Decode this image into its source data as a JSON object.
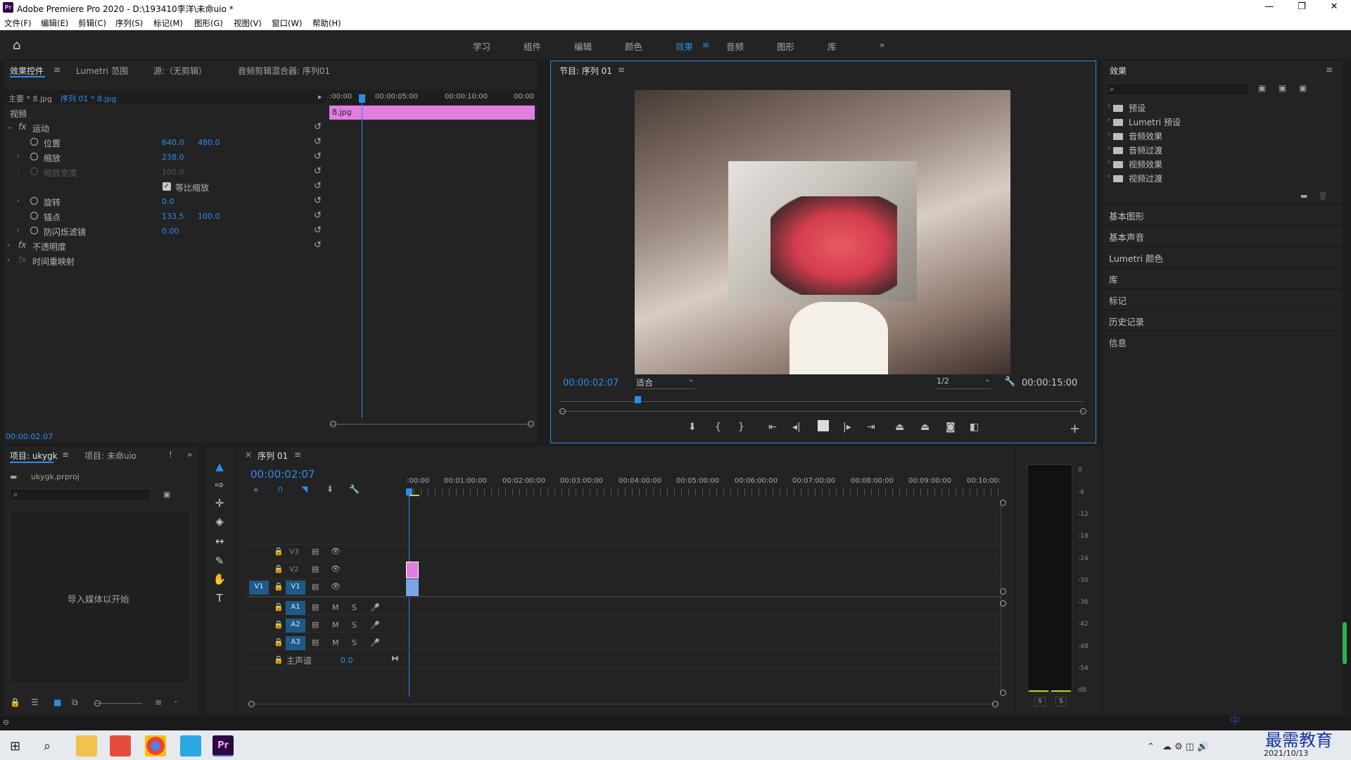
{
  "window": {
    "title": "Adobe Premiere Pro 2020 - D:\\193410李洋\\未命uio *",
    "logo": "Pr"
  },
  "menu": [
    "文件(F)",
    "编辑(E)",
    "剪辑(C)",
    "序列(S)",
    "标记(M)",
    "图形(G)",
    "视图(V)",
    "窗口(W)",
    "帮助(H)"
  ],
  "workspaces": [
    "学习",
    "组件",
    "编辑",
    "颜色",
    "效果",
    "音频",
    "图形",
    "库"
  ],
  "effect_controls": {
    "tabs": [
      "效果控件",
      "Lumetri 范围",
      "源:（无剪辑）",
      "音频剪辑混合器: 序列01"
    ],
    "master": "主要 * 8.jpg",
    "sequence": "序列 01 * 8.jpg",
    "timecodes": [
      ":00:00",
      "00:00:05:00",
      "00:00:10:00",
      "00:00"
    ],
    "clip_name": "8.jpg",
    "section": "视频",
    "motion": "运动",
    "props": {
      "position": {
        "label": "位置",
        "x": "640.0",
        "y": "480.0"
      },
      "scale": {
        "label": "缩放",
        "v": "238.0"
      },
      "scale_width": {
        "label": "缩放宽度",
        "v": "100.0"
      },
      "uniform": "等比缩放",
      "rotation": {
        "label": "旋转",
        "v": "0.0"
      },
      "anchor": {
        "label": "锚点",
        "x": "133.5",
        "y": "100.0"
      },
      "flicker": {
        "label": "防闪烁滤镜",
        "v": "0.00"
      }
    },
    "opacity": "不透明度",
    "time_remap": "时间重映射",
    "current_time": "00:00:02:07"
  },
  "program": {
    "title": "节目: 序列 01",
    "timecode": "00:00:02:07",
    "fit": "适合",
    "resolution": "1/2",
    "duration": "00:00:15:00"
  },
  "effects": {
    "title": "效果",
    "tree": [
      "预设",
      "Lumetri 预设",
      "音频效果",
      "音频过渡",
      "视频效果",
      "视频过渡"
    ],
    "panels": [
      "基本图形",
      "基本声音",
      "Lumetri 颜色",
      "库",
      "标记",
      "历史记录",
      "信息"
    ]
  },
  "project": {
    "tabs": [
      "项目: ukygk",
      "项目: 未命uio"
    ],
    "file": "ukygk.prproj",
    "empty": "导入媒体以开始"
  },
  "timeline": {
    "title": "序列 01",
    "timecode": "00:00:02:07",
    "ruler": [
      ":00:00",
      "00:01:00:00",
      "00:02:00:00",
      "00:03:00:00",
      "00:04:00:00",
      "00:05:00:00",
      "00:06:00:00",
      "00:07:00:00",
      "00:08:00:00",
      "00:09:00:00",
      "00:10:00:"
    ],
    "video_tracks": [
      "V3",
      "V2",
      "V1"
    ],
    "audio_tracks": [
      "A1",
      "A2",
      "A3"
    ],
    "source_patch": "V1",
    "master": "主声道",
    "master_val": "0.0",
    "m": "M",
    "s": "S"
  },
  "meter": {
    "scale": [
      "0",
      "-6",
      "-12",
      "-18",
      "-24",
      "-30",
      "-36",
      "-42",
      "-48",
      "-54",
      "dB"
    ],
    "solo": [
      "S",
      "S"
    ]
  },
  "taskbar": {
    "date": "2021/10/13",
    "watermark": "最需教育",
    "ime": "中"
  }
}
